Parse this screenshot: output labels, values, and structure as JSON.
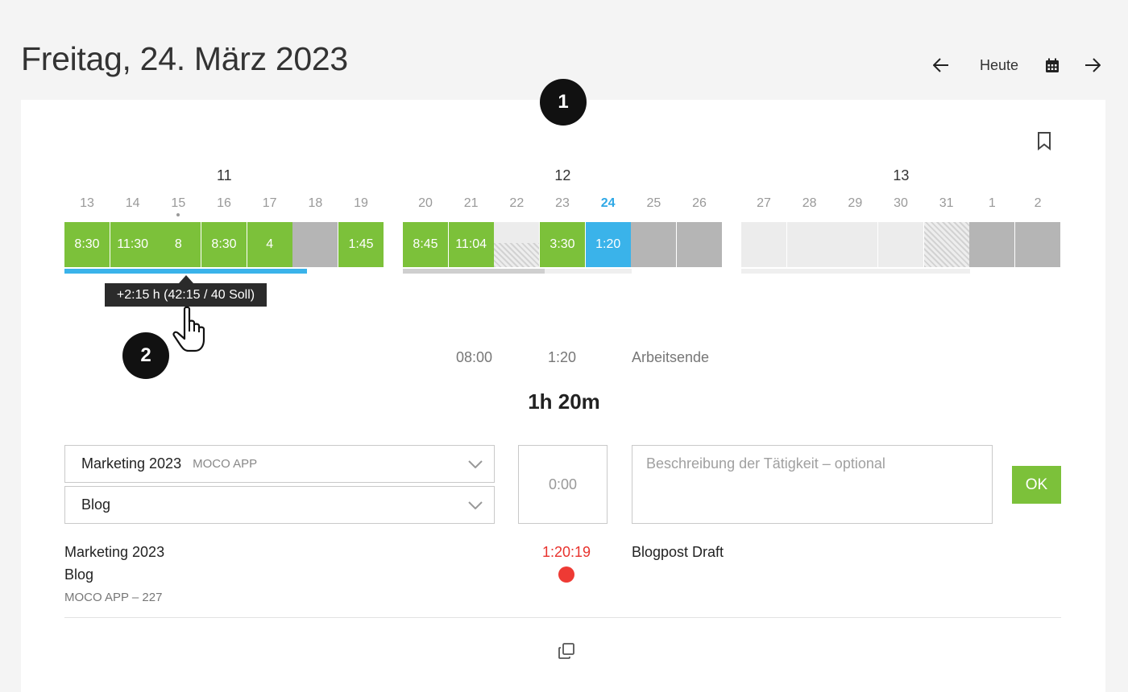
{
  "header": {
    "title": "Freitag, 24. März 2023",
    "today_label": "Heute"
  },
  "badges": [
    "1",
    "2"
  ],
  "weeks": [
    {
      "label": "11",
      "progress": 0.765,
      "progress_color": "#3ab3ea",
      "days": [
        {
          "day": "13",
          "value": "8:30",
          "state": "filled"
        },
        {
          "day": "14",
          "value": "11:30",
          "state": "filled"
        },
        {
          "day": "15",
          "value": "8",
          "state": "filled",
          "dot": true
        },
        {
          "day": "16",
          "value": "8:30",
          "state": "filled"
        },
        {
          "day": "17",
          "value": "4",
          "state": "filled"
        },
        {
          "day": "18",
          "value": "",
          "state": "weekend"
        },
        {
          "day": "19",
          "value": "1:45",
          "state": "filled"
        }
      ]
    },
    {
      "label": "12",
      "progress": 0.62,
      "progress_color": "#cfcfcf",
      "days": [
        {
          "day": "20",
          "value": "8:45",
          "state": "filled"
        },
        {
          "day": "21",
          "value": "11:04",
          "state": "filled"
        },
        {
          "day": "22",
          "value": "",
          "state": "half-absence"
        },
        {
          "day": "23",
          "value": "3:30",
          "state": "filled"
        },
        {
          "day": "24",
          "value": "1:20",
          "state": "today"
        },
        {
          "day": "25",
          "value": "",
          "state": "weekend"
        },
        {
          "day": "26",
          "value": "",
          "state": "weekend"
        }
      ]
    },
    {
      "label": "13",
      "progress": 0,
      "progress_color": "#cfcfcf",
      "days": [
        {
          "day": "27",
          "value": "",
          "state": "empty"
        },
        {
          "day": "28",
          "value": "",
          "state": "empty"
        },
        {
          "day": "29",
          "value": "",
          "state": "empty"
        },
        {
          "day": "30",
          "value": "",
          "state": "empty"
        },
        {
          "day": "31",
          "value": "",
          "state": "absence"
        },
        {
          "day": "1",
          "value": "",
          "state": "weekend"
        },
        {
          "day": "2",
          "value": "",
          "state": "weekend"
        }
      ]
    }
  ],
  "tooltip": "+2:15 h (42:15 / 40 Soll)",
  "timeline": {
    "start": "08:00",
    "current": "1:20",
    "end_label": "Arbeitsende"
  },
  "total": "1h 20m",
  "form": {
    "project": "Marketing 2023",
    "customer": "MOCO APP",
    "task": "Blog",
    "duration_placeholder": "0:00",
    "description_placeholder": "Beschreibung der Tätigkeit – optional",
    "ok_label": "OK"
  },
  "entry": {
    "project": "Marketing 2023",
    "task": "Blog",
    "meta": "MOCO APP – 227",
    "timer": "1:20:19",
    "description": "Blogpost Draft"
  },
  "colors": {
    "filled": "#7cc13a",
    "today": "#3ab3ea",
    "recording": "#ee3a34"
  }
}
